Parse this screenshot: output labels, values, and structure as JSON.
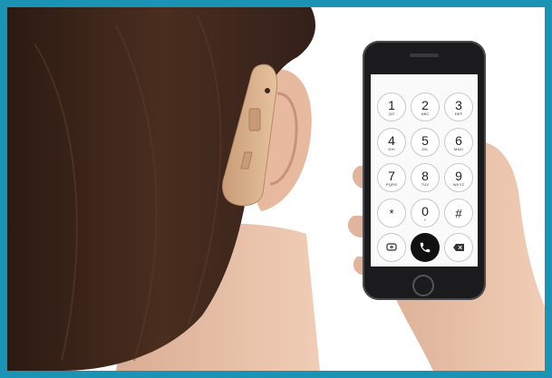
{
  "keypad": [
    {
      "digit": "1",
      "letters": "QO"
    },
    {
      "digit": "2",
      "letters": "ABC"
    },
    {
      "digit": "3",
      "letters": "DEF"
    },
    {
      "digit": "4",
      "letters": "GHI"
    },
    {
      "digit": "5",
      "letters": "JKL"
    },
    {
      "digit": "6",
      "letters": "MNO"
    },
    {
      "digit": "7",
      "letters": "PQRS"
    },
    {
      "digit": "8",
      "letters": "TUV"
    },
    {
      "digit": "9",
      "letters": "WXYZ"
    },
    {
      "digit": "*",
      "letters": ""
    },
    {
      "digit": "0",
      "letters": "+"
    },
    {
      "digit": "#",
      "letters": ""
    }
  ],
  "icons": {
    "message": "message-icon",
    "call": "phone-call-icon",
    "delete": "backspace-icon"
  },
  "colors": {
    "border": "#1a93b5",
    "background": "#ffffff",
    "hair": "#3a2418",
    "skin": "#e8c3ac",
    "hearing_aid": "#d8b08c",
    "phone_body": "#1b1b1d"
  }
}
